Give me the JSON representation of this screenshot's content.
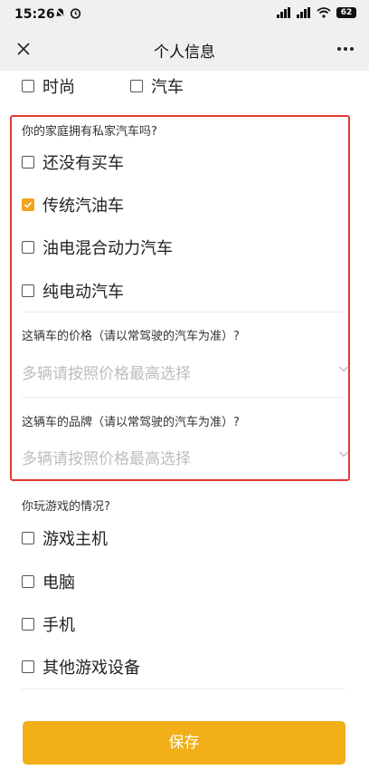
{
  "status_bar": {
    "time": "15:26",
    "battery": "62"
  },
  "nav": {
    "title": "个人信息"
  },
  "interests": {
    "options": [
      {
        "label": "时尚",
        "checked": false
      },
      {
        "label": "汽车",
        "checked": false
      }
    ]
  },
  "car_ownership": {
    "question": "你的家庭拥有私家汽车吗?",
    "options": [
      {
        "label": "还没有买车",
        "checked": false
      },
      {
        "label": "传统汽油车",
        "checked": true
      },
      {
        "label": "油电混合动力汽车",
        "checked": false
      },
      {
        "label": "纯电动汽车",
        "checked": false
      }
    ]
  },
  "car_price": {
    "question": "这辆车的价格（请以常驾驶的汽车为准）?",
    "placeholder": "多辆请按照价格最高选择"
  },
  "car_brand": {
    "question": "这辆车的品牌（请以常驾驶的汽车为准）?",
    "placeholder": "多辆请按照价格最高选择"
  },
  "gaming": {
    "question": "你玩游戏的情况?",
    "options": [
      {
        "label": "游戏主机",
        "checked": false
      },
      {
        "label": "电脑",
        "checked": false
      },
      {
        "label": "手机",
        "checked": false
      },
      {
        "label": "其他游戏设备",
        "checked": false
      }
    ]
  },
  "footer": {
    "save_label": "保存"
  },
  "colors": {
    "accent": "#f2a51d",
    "highlight": "#e53935"
  }
}
